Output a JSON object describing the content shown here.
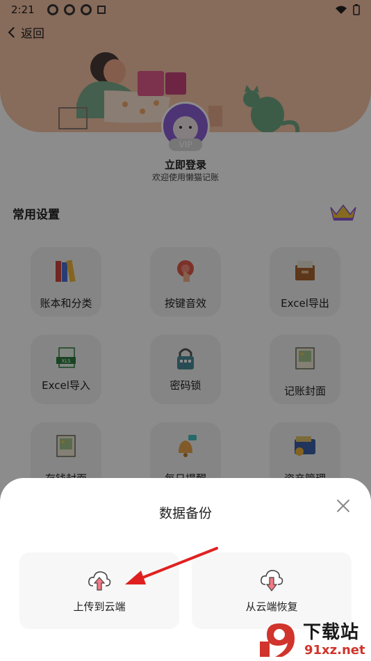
{
  "statusbar": {
    "time": "2:21"
  },
  "nav": {
    "back_label": "返回"
  },
  "profile": {
    "vip_badge": "VIP",
    "login_title": "立即登录",
    "login_subtitle": "欢迎使用懒猫记账"
  },
  "settings": {
    "title": "常用设置",
    "items": [
      {
        "label": "账本和分类",
        "icon": "books-icon"
      },
      {
        "label": "按键音效",
        "icon": "tap-button-icon"
      },
      {
        "label": "Excel导出",
        "icon": "file-box-icon"
      },
      {
        "label": "Excel导入",
        "icon": "xls-icon"
      },
      {
        "label": "密码锁",
        "icon": "lock-icon"
      },
      {
        "label": "记账封面",
        "icon": "picture-icon"
      },
      {
        "label": "存钱封面",
        "icon": "picture-icon"
      },
      {
        "label": "每日提醒",
        "icon": "bell-icon"
      },
      {
        "label": "资产管理",
        "icon": "wallet-icon"
      }
    ]
  },
  "dialog": {
    "title": "数据备份",
    "upload_label": "上传到云端",
    "restore_label": "从云端恢复"
  },
  "watermark": {
    "main": "下载站",
    "sub": "91xz.net"
  },
  "colors": {
    "hero": "#f6c4a6",
    "arrow": "#e02020",
    "icon_pink": "#f07a86"
  }
}
